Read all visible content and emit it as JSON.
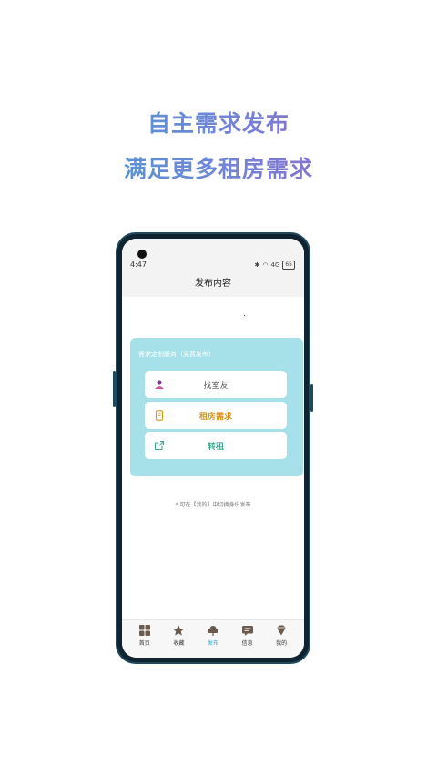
{
  "promo": {
    "line1": "自主需求发布",
    "line2": "满足更多租房需求",
    "gradient": [
      "#3fa3cf",
      "#6f86d8",
      "#a35bc4"
    ]
  },
  "status_bar": {
    "time": "4:47",
    "signal_text": "4G",
    "battery": "65"
  },
  "nav": {
    "title": "发布内容"
  },
  "publish_card": {
    "title": "需求定制服务（免费发布）",
    "options": [
      {
        "label": "找室友",
        "icon": "roommate-icon",
        "color": "#555555"
      },
      {
        "label": "租房需求",
        "icon": "phone-doc-icon",
        "color": "#d9951c"
      },
      {
        "label": "转租",
        "icon": "share-icon",
        "color": "#3aa893"
      }
    ]
  },
  "hint": "* 可在【我的】中切换身份发布",
  "tabbar": {
    "items": [
      {
        "label": "首页",
        "icon": "home-grid-icon",
        "active": false
      },
      {
        "label": "收藏",
        "icon": "star-icon",
        "active": false
      },
      {
        "label": "发布",
        "icon": "cloud-publish-icon",
        "active": true
      },
      {
        "label": "信息",
        "icon": "message-icon",
        "active": false
      },
      {
        "label": "我的",
        "icon": "profile-icon",
        "active": false
      }
    ]
  }
}
